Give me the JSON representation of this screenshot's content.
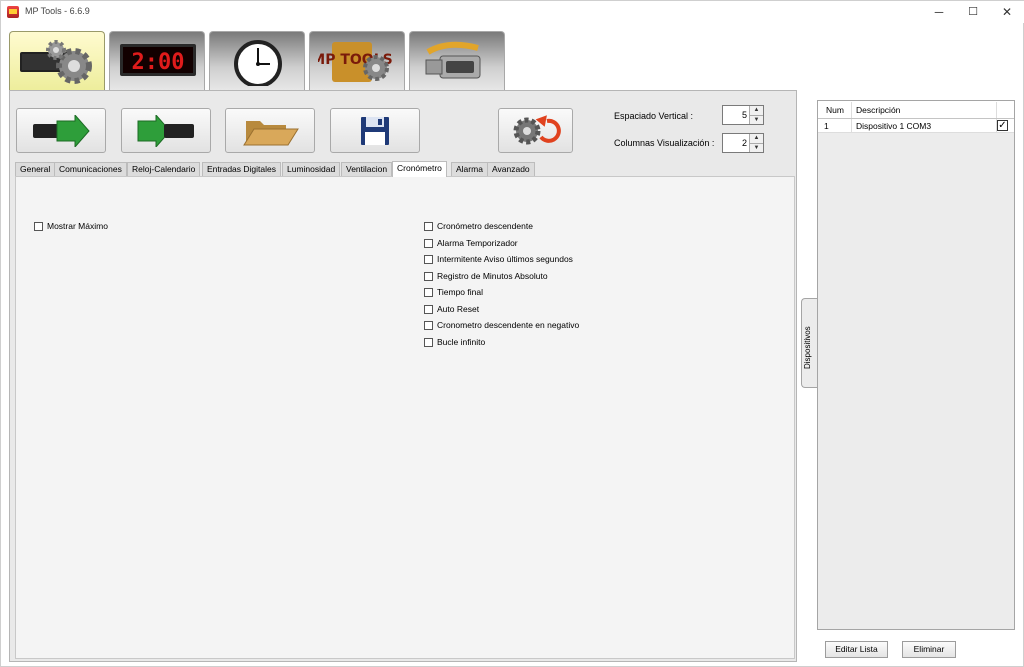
{
  "window": {
    "title": "MP Tools - 6.6.9",
    "controls": {
      "minimize": "─",
      "maximize": "☐",
      "close": "✕"
    }
  },
  "main_tabs": [
    {
      "icon": "settings-display-icon"
    },
    {
      "icon": "led-clock-display-icon",
      "display_text": "2:00"
    },
    {
      "icon": "analog-clock-icon"
    },
    {
      "icon": "mp-tools-logo-icon",
      "logo_text": "MP TOOLS"
    },
    {
      "icon": "serial-cable-icon"
    }
  ],
  "toolbar": {
    "buttons": [
      {
        "icon": "send-to-display-icon"
      },
      {
        "icon": "receive-from-display-icon"
      },
      {
        "icon": "open-folder-icon"
      },
      {
        "icon": "save-floppy-icon"
      },
      {
        "icon": "reset-settings-icon"
      }
    ],
    "vertical_spacing_label": "Espaciado Vertical :",
    "vertical_spacing_value": "5",
    "display_columns_label": "Columnas Visualización :",
    "display_columns_value": "2"
  },
  "sub_tabs": [
    "General",
    "Comunicaciones",
    "Reloj-Calendario",
    "Entradas Digitales",
    "Luminosidad",
    "Ventilacion",
    "Cronómetro",
    "Alarma",
    "Avanzado"
  ],
  "active_sub_tab": "Cronómetro",
  "left_options": [
    {
      "label": "Mostrar Máximo",
      "checked": false
    }
  ],
  "right_options": [
    {
      "label": "Cronómetro descendente",
      "checked": false
    },
    {
      "label": "Alarma Temporizador",
      "checked": false
    },
    {
      "label": "Intermitente Aviso últimos segundos",
      "checked": false
    },
    {
      "label": "Registro de Minutos Absoluto",
      "checked": false
    },
    {
      "label": "Tiempo final",
      "checked": false
    },
    {
      "label": "Auto Reset",
      "checked": false
    },
    {
      "label": "Cronometro descendente en negativo",
      "checked": false
    },
    {
      "label": "Bucle infinito",
      "checked": false
    }
  ],
  "side_tab": "Dispositivos",
  "devices": {
    "columns": [
      "Num",
      "Descripción"
    ],
    "rows": [
      {
        "num": "1",
        "description": "Dispositivo 1 COM3",
        "checked": true
      }
    ]
  },
  "buttons": {
    "edit_list": "Editar Lista",
    "delete": "Eliminar"
  },
  "colors": {
    "active_tab": "#fffbd0",
    "arrow_green": "#2e9e3a",
    "led_red": "#e01b1b",
    "folder": "#d9a85a"
  }
}
